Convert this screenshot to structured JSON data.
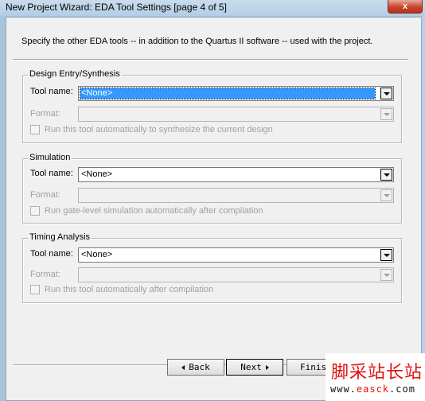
{
  "window": {
    "title": "New Project Wizard: EDA Tool Settings [page 4 of 5]",
    "close_glyph": "x"
  },
  "intro": "Specify the other EDA tools -- in addition to the Quartus II software -- used with the project.",
  "groups": {
    "design_entry": {
      "legend": "Design Entry/Synthesis",
      "tool_label": "Tool name:",
      "tool_value": "<None>",
      "format_label": "Format:",
      "run_label": "Run this tool automatically to synthesize the current design"
    },
    "simulation": {
      "legend": "Simulation",
      "tool_label": "Tool name:",
      "tool_value": "<None>",
      "format_label": "Format:",
      "run_label": "Run gate-level simulation automatically after compilation"
    },
    "timing": {
      "legend": "Timing Analysis",
      "tool_label": "Tool name:",
      "tool_value": "<None>",
      "format_label": "Format:",
      "run_label": "Run this tool automatically after compilation"
    }
  },
  "buttons": {
    "back": "Back",
    "next": "Next",
    "finish": "Finish"
  },
  "watermark": {
    "title": "脚采站长站",
    "url_prefix": "www.",
    "url_name": "easck",
    "url_suffix": ".com"
  },
  "icons": [
    "close-icon",
    "chevron-down-icon",
    "arrow-left-icon",
    "arrow-right-icon"
  ],
  "colors": {
    "selection": "#3399ff",
    "titlebar": "#c9dcee",
    "close": "#c9452e",
    "watermark": "#e01010"
  }
}
